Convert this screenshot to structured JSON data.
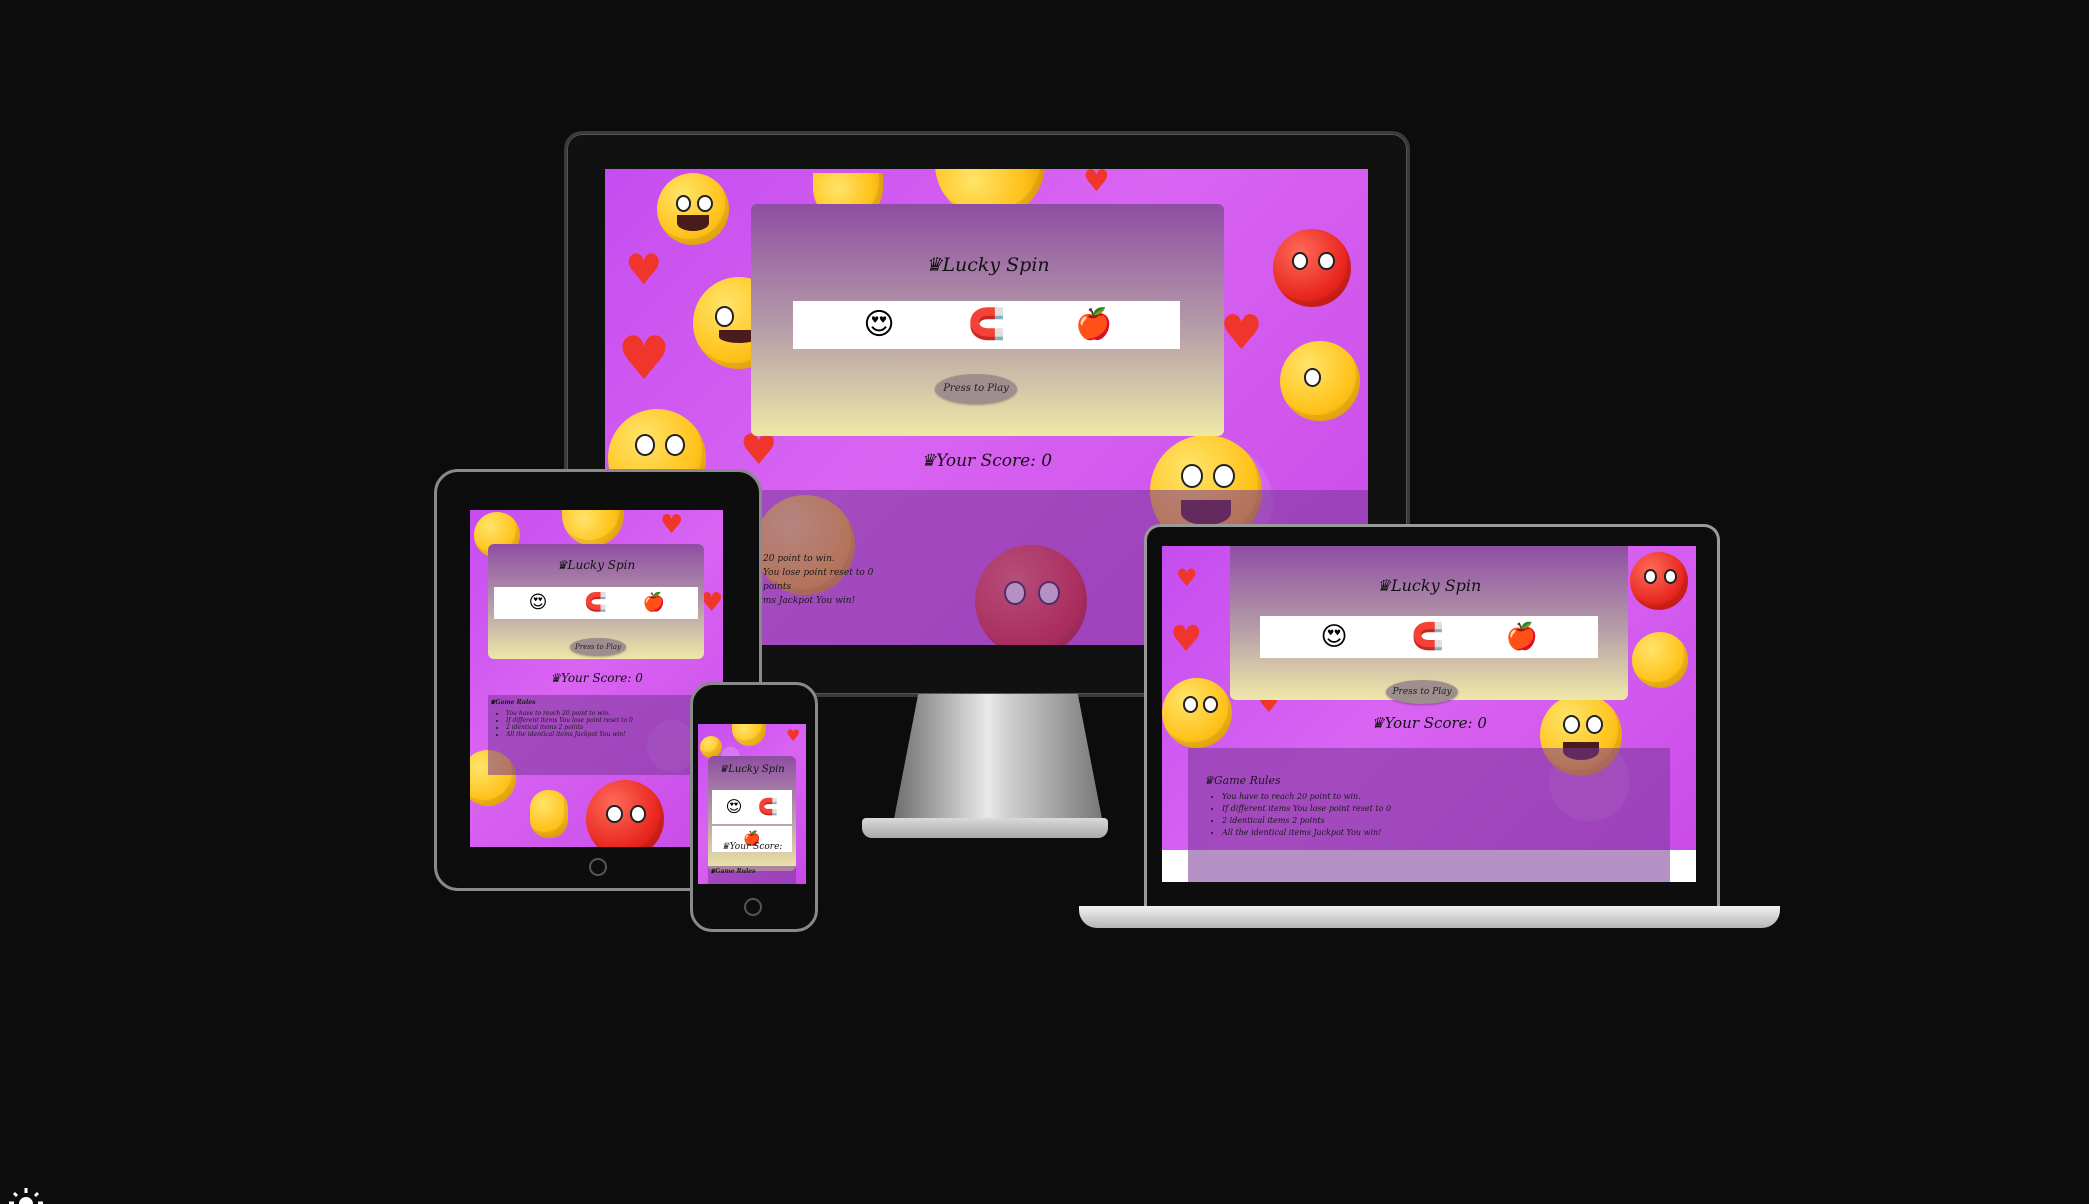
{
  "app": {
    "title": "Lucky Spin",
    "play_label": "Press to Play",
    "score_label": "Your Score: ",
    "score_value": "0",
    "reels": [
      "😍",
      "🧲",
      "🍎"
    ],
    "rules_title": "Game Rules",
    "rules": [
      "You have to reach 20 point to win.",
      "If different items You lose point reset to 0",
      "2 identical items 2 points",
      "All the identical items Jackpot You win!"
    ]
  },
  "desktop_rules_fragments": [
    "20 point to win.",
    "You lose point reset to 0",
    "points",
    "items Jackpot You win!"
  ],
  "colors": {
    "background": "#0c0c0c",
    "screen": "#d35cf0",
    "panel_top": "#8e4ea3",
    "panel_bottom": "#eee8a8",
    "button": "#9e8e8e"
  },
  "icons": {
    "crown": "♛",
    "heart": "♥"
  }
}
